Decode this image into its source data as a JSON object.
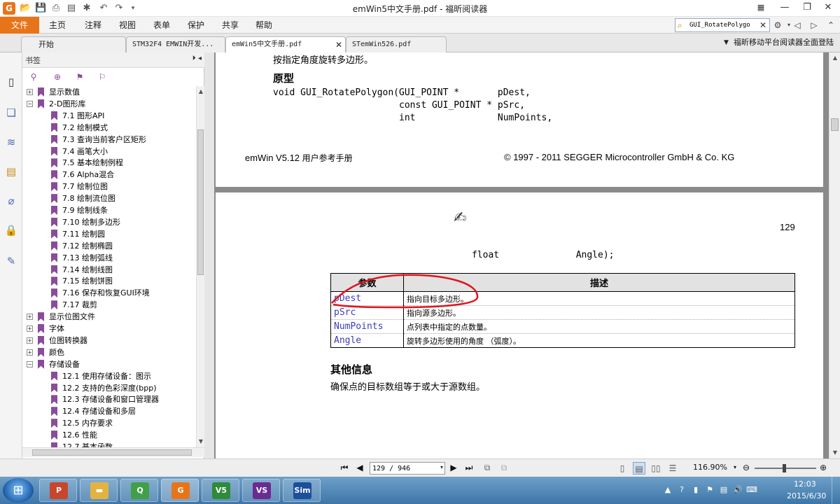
{
  "window": {
    "title": "emWin5中文手册.pdf - 福昕阅读器",
    "logo": "G"
  },
  "menu": {
    "file": "文件",
    "items": [
      "主页",
      "注释",
      "视图",
      "表单",
      "保护",
      "共享",
      "帮助"
    ]
  },
  "find": {
    "value": "GUI_RotatePolygo"
  },
  "tabs": [
    {
      "label": "开始",
      "active": false,
      "closable": false
    },
    {
      "label": "STM32F4 EMWIN开发...",
      "active": false,
      "closable": false
    },
    {
      "label": "emWin5中文手册.pdf",
      "active": true,
      "closable": true
    },
    {
      "label": "STemWin526.pdf",
      "active": false,
      "closable": false
    }
  ],
  "promo": "福昕移动平台阅读器全面登陆",
  "bookmarks": {
    "title": "书签",
    "items": [
      {
        "level": 0,
        "expander": "+",
        "label": "显示数值"
      },
      {
        "level": 0,
        "expander": "−",
        "label": "2-D图形库"
      },
      {
        "level": 1,
        "expander": "",
        "label": "7.1 图形API"
      },
      {
        "level": 1,
        "expander": "",
        "label": "7.2 绘制模式"
      },
      {
        "level": 1,
        "expander": "",
        "label": "7.3 查询当前客户区矩形"
      },
      {
        "level": 1,
        "expander": "",
        "label": "7.4 画笔大小"
      },
      {
        "level": 1,
        "expander": "",
        "label": "7.5 基本绘制例程"
      },
      {
        "level": 1,
        "expander": "",
        "label": "7.6 Alpha混合"
      },
      {
        "level": 1,
        "expander": "",
        "label": "7.7 绘制位图"
      },
      {
        "level": 1,
        "expander": "",
        "label": "7.8 绘制流位图"
      },
      {
        "level": 1,
        "expander": "",
        "label": "7.9 绘制线条"
      },
      {
        "level": 1,
        "expander": "",
        "label": "7.10 绘制多边形"
      },
      {
        "level": 1,
        "expander": "",
        "label": "7.11 绘制圆"
      },
      {
        "level": 1,
        "expander": "",
        "label": "7.12 绘制椭圆"
      },
      {
        "level": 1,
        "expander": "",
        "label": "7.13 绘制弧线"
      },
      {
        "level": 1,
        "expander": "",
        "label": "7.14 绘制线图"
      },
      {
        "level": 1,
        "expander": "",
        "label": "7.15 绘制饼图"
      },
      {
        "level": 1,
        "expander": "",
        "label": "7.16 保存和恢复GUI环境"
      },
      {
        "level": 1,
        "expander": "",
        "label": "7.17 裁剪"
      },
      {
        "level": 0,
        "expander": "+",
        "label": "显示位图文件"
      },
      {
        "level": 0,
        "expander": "+",
        "label": "字体"
      },
      {
        "level": 0,
        "expander": "+",
        "label": "位图转换器"
      },
      {
        "level": 0,
        "expander": "+",
        "label": "颜色"
      },
      {
        "level": 0,
        "expander": "−",
        "label": "存储设备"
      },
      {
        "level": 1,
        "expander": "",
        "label": "12.1 使用存储设备：图示"
      },
      {
        "level": 1,
        "expander": "",
        "label": "12.2 支持的色彩深度(bpp)"
      },
      {
        "level": 1,
        "expander": "",
        "label": "12.3 存储设备和窗口管理器"
      },
      {
        "level": 1,
        "expander": "",
        "label": "12.4 存储设备和多层"
      },
      {
        "level": 1,
        "expander": "",
        "label": "12.5 内存要求"
      },
      {
        "level": 1,
        "expander": "",
        "label": "12.6 性能"
      },
      {
        "level": 1,
        "expander": "",
        "label": "12.7 基本函数"
      }
    ]
  },
  "doc": {
    "page1": {
      "intro": "按指定角度旋转多边形。",
      "heading": "原型",
      "proto_line1": "void GUI_RotatePolygon(GUI_POINT *       pDest,",
      "proto_line2": "                       const GUI_POINT * pSrc,",
      "proto_line3": "                       int               NumPoints,",
      "footer_left_prefix": "emWin V5.12 ",
      "footer_left_suffix": "用户参考手册",
      "footer_right": "© 1997 - 2011 SEGGER Microcontroller GmbH & Co. KG"
    },
    "page2": {
      "page_number": "129",
      "proto_cont": "float              Angle);",
      "table": {
        "headers": [
          "参数",
          "描述"
        ],
        "rows": [
          {
            "param": "pDest",
            "desc": "指向目标多边形。"
          },
          {
            "param": "pSrc",
            "desc": "指向源多边形。"
          },
          {
            "param": "NumPoints",
            "desc": "点列表中指定的点数量。"
          },
          {
            "param": "Angle",
            "desc": "旋转多边形使用的角度 （弧度）。"
          }
        ]
      },
      "other_heading": "其他信息",
      "other_text": "确保点的目标数组等于或大于源数组。"
    }
  },
  "status": {
    "page_field": "129 / 946",
    "zoom": "116.90%"
  },
  "taskbar": {
    "apps": [
      {
        "name": "powerpoint",
        "glyph": "P",
        "color": "#c8462b"
      },
      {
        "name": "explorer",
        "glyph": "▬",
        "color": "#e3b341"
      },
      {
        "name": "qt-creator",
        "glyph": "Q",
        "color": "#41a047"
      },
      {
        "name": "foxit-reader",
        "glyph": "G",
        "color": "#e8741a"
      },
      {
        "name": "visual-studio-2015",
        "glyph": "V5",
        "color": "#2e8b3a"
      },
      {
        "name": "visual-studio",
        "glyph": "VS",
        "color": "#6a2c91"
      },
      {
        "name": "emwin-simulator",
        "glyph": "Sim",
        "color": "#1b4f9c"
      }
    ],
    "clock_time": "12:03",
    "clock_date": "2015/6/30"
  }
}
